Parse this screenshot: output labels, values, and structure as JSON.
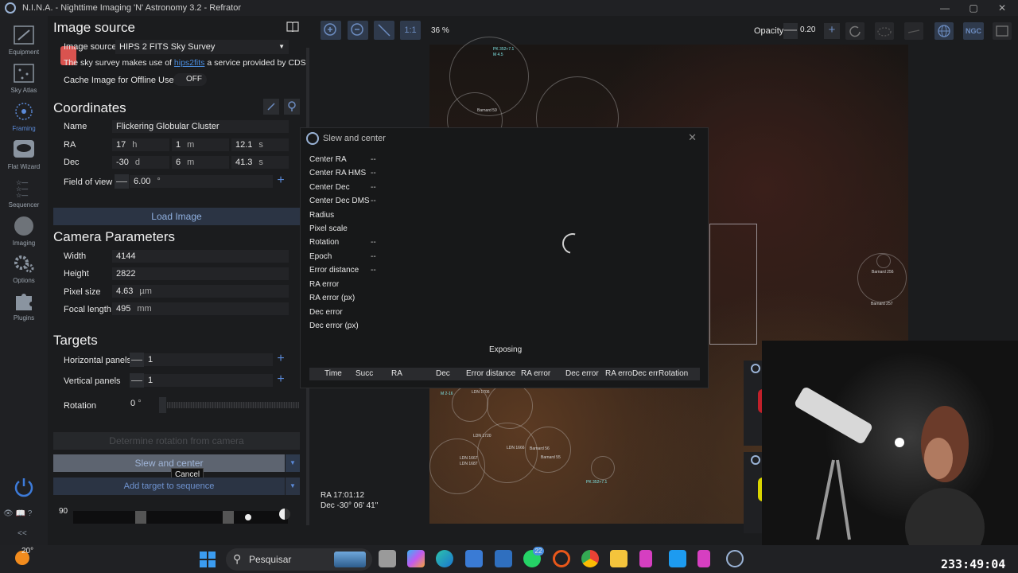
{
  "window": {
    "title": "N.I.N.A. - Nighttime Imaging 'N' Astronomy 3.2  -  Refrator"
  },
  "nav": [
    {
      "label": "Equipment",
      "icon": "telescope-icon"
    },
    {
      "label": "Sky Atlas",
      "icon": "atlas-icon"
    },
    {
      "label": "Framing",
      "icon": "framing-icon"
    },
    {
      "label": "Flat Wizard",
      "icon": "flat-wizard-icon"
    },
    {
      "label": "Sequencer",
      "icon": "sequencer-icon"
    },
    {
      "label": "Imaging",
      "icon": "imaging-icon"
    },
    {
      "label": "Options",
      "icon": "gear-icon"
    },
    {
      "label": "Plugins",
      "icon": "plugin-icon"
    }
  ],
  "nav_collapse": "<<",
  "image_source": {
    "heading": "Image source",
    "label": "Image source",
    "value": "HIPS 2 FITS Sky Survey",
    "note_prefix": "The sky survey makes use of",
    "note_link": "hips2fits",
    "note_suffix": "a service provided by CDS",
    "cache_label": "Cache Image for Offline Use",
    "cache_state": "OFF"
  },
  "coordinates": {
    "heading": "Coordinates",
    "name_label": "Name",
    "name_value": "Flickering Globular Cluster",
    "ra_label": "RA",
    "ra_h": "17",
    "ra_h_unit": "h",
    "ra_m": "1",
    "ra_m_unit": "m",
    "ra_s": "12.1",
    "ra_s_unit": "s",
    "dec_label": "Dec",
    "dec_d": "-30",
    "dec_d_unit": "d",
    "dec_m": "6",
    "dec_m_unit": "m",
    "dec_s": "41.3",
    "dec_s_unit": "s",
    "fov_label": "Field of view",
    "fov_value": "6.00",
    "fov_unit": "°",
    "load_button": "Load Image"
  },
  "camera": {
    "heading": "Camera Parameters",
    "width_label": "Width",
    "width_value": "4144",
    "height_label": "Height",
    "height_value": "2822",
    "pixel_label": "Pixel size",
    "pixel_value": "4.63",
    "pixel_unit": "µm",
    "focal_label": "Focal length",
    "focal_value": "495",
    "focal_unit": "mm"
  },
  "targets": {
    "heading": "Targets",
    "hpanels_label": "Horizontal panels",
    "hpanels_value": "1",
    "vpanels_label": "Vertical panels",
    "vpanels_value": "1",
    "rotation_label": "Rotation",
    "rotation_value": "0",
    "rotation_unit": "°",
    "determine_button": "Determine rotation from camera",
    "slew_button": "Slew and center",
    "cancel_tooltip": "Cancel",
    "add_button": "Add target to sequence"
  },
  "bottom_strip": {
    "altitude": "90"
  },
  "toolbar": {
    "zoom_label": "1:1",
    "zoom_percent": "36 %",
    "opacity_label": "Opacity",
    "opacity_value": "0.20",
    "ngc_label": "NGC"
  },
  "sky": {
    "ra_readout": "RA  17:01:12",
    "dec_readout": "Dec  -30° 06' 41\"",
    "objects": [
      {
        "label": "PK 352+7.1",
        "cyan": true
      },
      {
        "label": "M 4.5",
        "cyan": true
      },
      {
        "label": "Barnard 59"
      },
      {
        "label": "Barnard 256"
      },
      {
        "label": "Barnard 257"
      },
      {
        "label": "LDN 1706"
      },
      {
        "label": "M 2-16",
        "cyan": true
      },
      {
        "label": "LDN 1720"
      },
      {
        "label": "LDN 1666"
      },
      {
        "label": "Barnard 56"
      },
      {
        "label": "LDN 1667"
      },
      {
        "label": "LDN 1687"
      },
      {
        "label": "PK 352+7.1",
        "cyan": true
      },
      {
        "label": "Barnard 55"
      }
    ]
  },
  "dialog": {
    "title": "Slew and center",
    "rows": [
      {
        "label": "Center RA",
        "value": "--"
      },
      {
        "label": "Center RA HMS",
        "value": "--"
      },
      {
        "label": "Center Dec",
        "value": "--"
      },
      {
        "label": "Center Dec DMS",
        "value": "--"
      },
      {
        "label": "Radius",
        "value": ""
      },
      {
        "label": "Pixel scale",
        "value": ""
      },
      {
        "label": "Rotation",
        "value": "--"
      },
      {
        "label": "Epoch",
        "value": "--"
      },
      {
        "label": "Error distance",
        "value": "--"
      },
      {
        "label": "RA error",
        "value": ""
      },
      {
        "label": "RA error (px)",
        "value": ""
      },
      {
        "label": "Dec error",
        "value": ""
      },
      {
        "label": "Dec error (px)",
        "value": ""
      }
    ],
    "status": "Exposing",
    "columns": [
      "Time",
      "Succ",
      "RA",
      "Dec",
      "Error distance",
      "RA error",
      "Dec error",
      "RA erro",
      "Dec err",
      "Rotation"
    ]
  },
  "taskbar": {
    "weather": "20°",
    "search_placeholder": "Pesquisar",
    "whatsapp_badge": "22"
  },
  "stream_timer": "233:49:04"
}
